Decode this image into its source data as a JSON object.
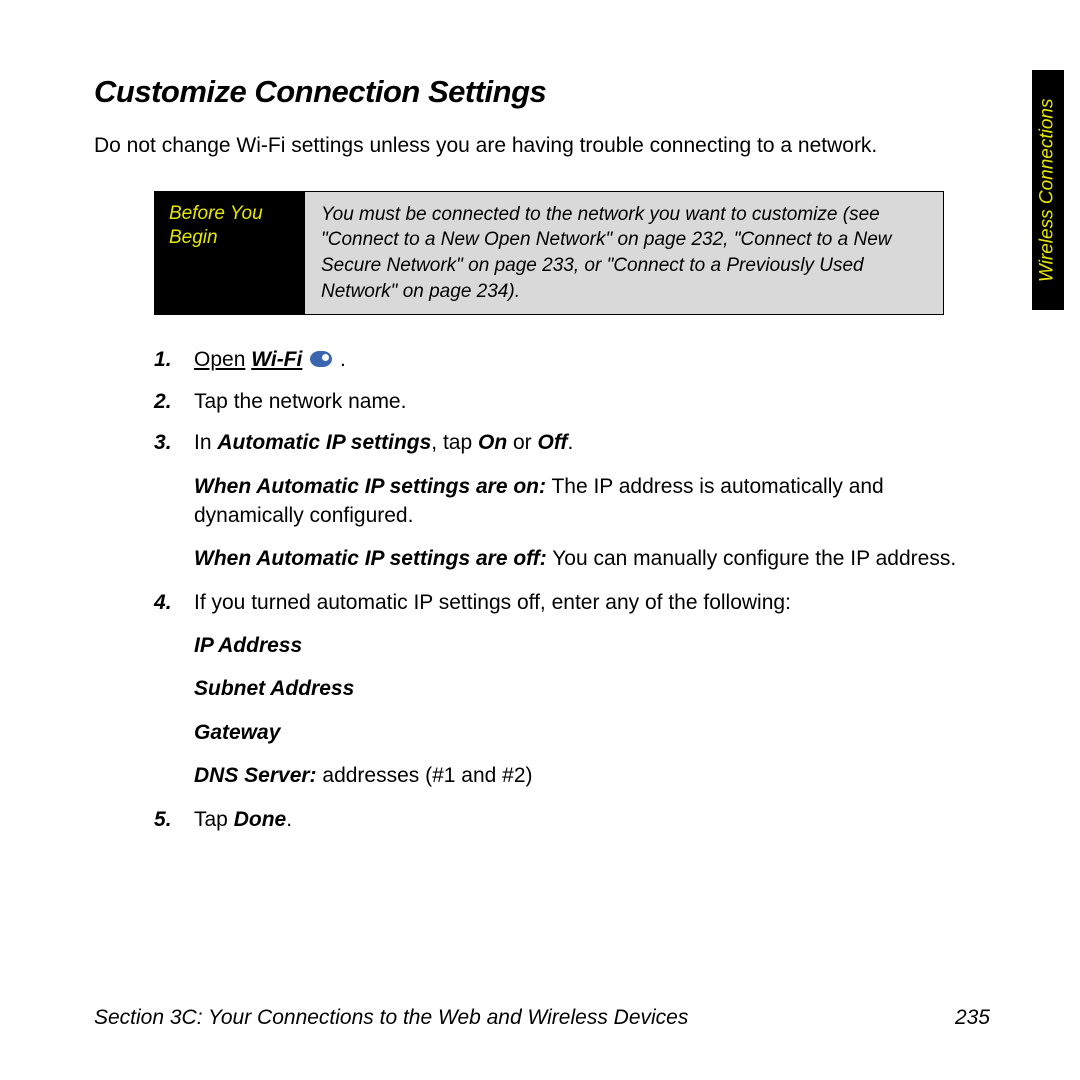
{
  "title": "Customize Connection Settings",
  "intro": "Do not change Wi-Fi settings unless you are having trouble connecting to a network.",
  "byb": {
    "label": "Before You Begin",
    "text": "You must be connected to the network you want to customize (see \"Connect to a New Open Network\" on page 232, \"Connect to a New Secure Network\" on page 233, or \"Connect to a Previously Used Network\" on page 234)."
  },
  "steps": {
    "s1_a": "Open",
    "s1_b": "Wi-Fi",
    "s1_c": ".",
    "s2": "Tap the network name.",
    "s3_a": "In ",
    "s3_b": "Automatic IP settings",
    "s3_c": ", tap ",
    "s3_d": "On",
    "s3_e": " or ",
    "s3_f": "Off",
    "s3_g": ".",
    "s3_on_a": "When Automatic IP settings are on:",
    "s3_on_b": " The IP address is automatically and dynamically configured.",
    "s3_off_a": "When Automatic IP settings are off:",
    "s3_off_b": " You can manually configure the IP address.",
    "s4": "If you turned automatic IP settings off, enter any of the following:",
    "s4_ip": "IP Address",
    "s4_subnet": "Subnet Address",
    "s4_gateway": "Gateway",
    "s4_dns_a": "DNS Server:",
    "s4_dns_b": " addresses (#1 and #2)",
    "s5_a": "Tap ",
    "s5_b": "Done",
    "s5_c": "."
  },
  "side_tab": "Wireless Connections",
  "footer": {
    "left": "Section 3C: Your Connections to the Web and Wireless Devices",
    "right": "235"
  }
}
